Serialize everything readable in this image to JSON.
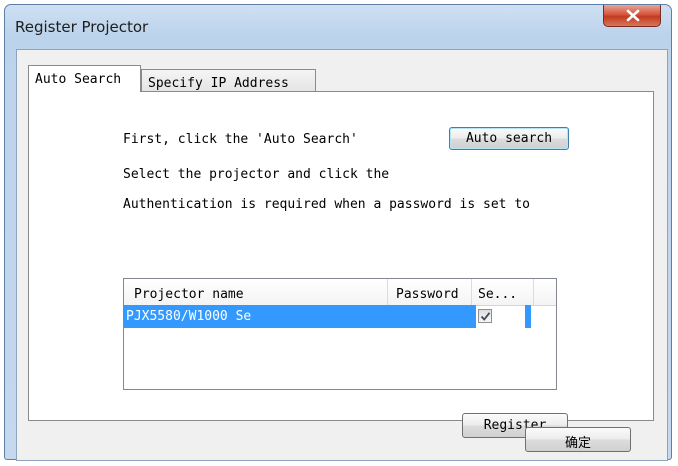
{
  "window": {
    "title": "Register Projector",
    "close_icon": "close-icon"
  },
  "tabs": [
    {
      "label": "Auto Search",
      "active": true
    },
    {
      "label": "Specify IP Address",
      "active": false
    }
  ],
  "auto_search": {
    "instruction_1": "First, click the 'Auto Search'",
    "instruction_2": "Select the projector and click the",
    "instruction_3": "Authentication is required when a password is set to",
    "auto_search_button": "Auto search"
  },
  "projector_list": {
    "columns": [
      "Projector name",
      "Password",
      "Se..."
    ],
    "rows": [
      {
        "name": "PJX5580/W1000 Se",
        "password": "",
        "selected": true,
        "checked": true
      }
    ]
  },
  "buttons": {
    "register": "Register",
    "ok": "确定"
  },
  "colors": {
    "selection": "#3399ff",
    "close_button": "#c8452a",
    "frame": "#bcd3ec"
  }
}
